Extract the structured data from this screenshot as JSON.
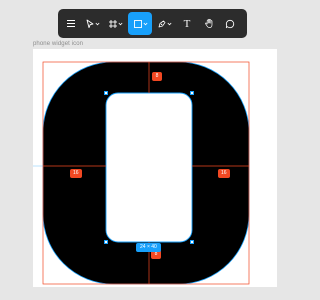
{
  "toolbar": {
    "tools": [
      {
        "name": "main-menu",
        "icon": "hamburger-menu-icon",
        "active": false
      },
      {
        "name": "move-tool",
        "icon": "cursor-arrow-icon",
        "active": false,
        "dropdown": true
      },
      {
        "name": "frame-tool",
        "icon": "frame-hash-icon",
        "active": false,
        "dropdown": true
      },
      {
        "name": "shape-tool",
        "icon": "rectangle-icon",
        "active": true,
        "dropdown": true
      },
      {
        "name": "pen-tool",
        "icon": "pen-nib-icon",
        "active": false,
        "dropdown": true
      },
      {
        "name": "text-tool",
        "icon": "text-t-icon",
        "active": false
      },
      {
        "name": "hand-tool",
        "icon": "hand-icon",
        "active": false
      },
      {
        "name": "comment-tool",
        "icon": "comment-bubble-icon",
        "active": false
      }
    ],
    "text_tool_glyph": "T"
  },
  "frame": {
    "label": "phone widget icon"
  },
  "measurements": {
    "top": "8",
    "bottom": "8",
    "left": "16",
    "right": "16"
  },
  "selection": {
    "dimensions": "24 × 40"
  },
  "colors": {
    "accent": "#18a0fb",
    "measure": "#f24822",
    "shape_fill": "#000000",
    "toolbar_bg": "#2c2c2c"
  }
}
